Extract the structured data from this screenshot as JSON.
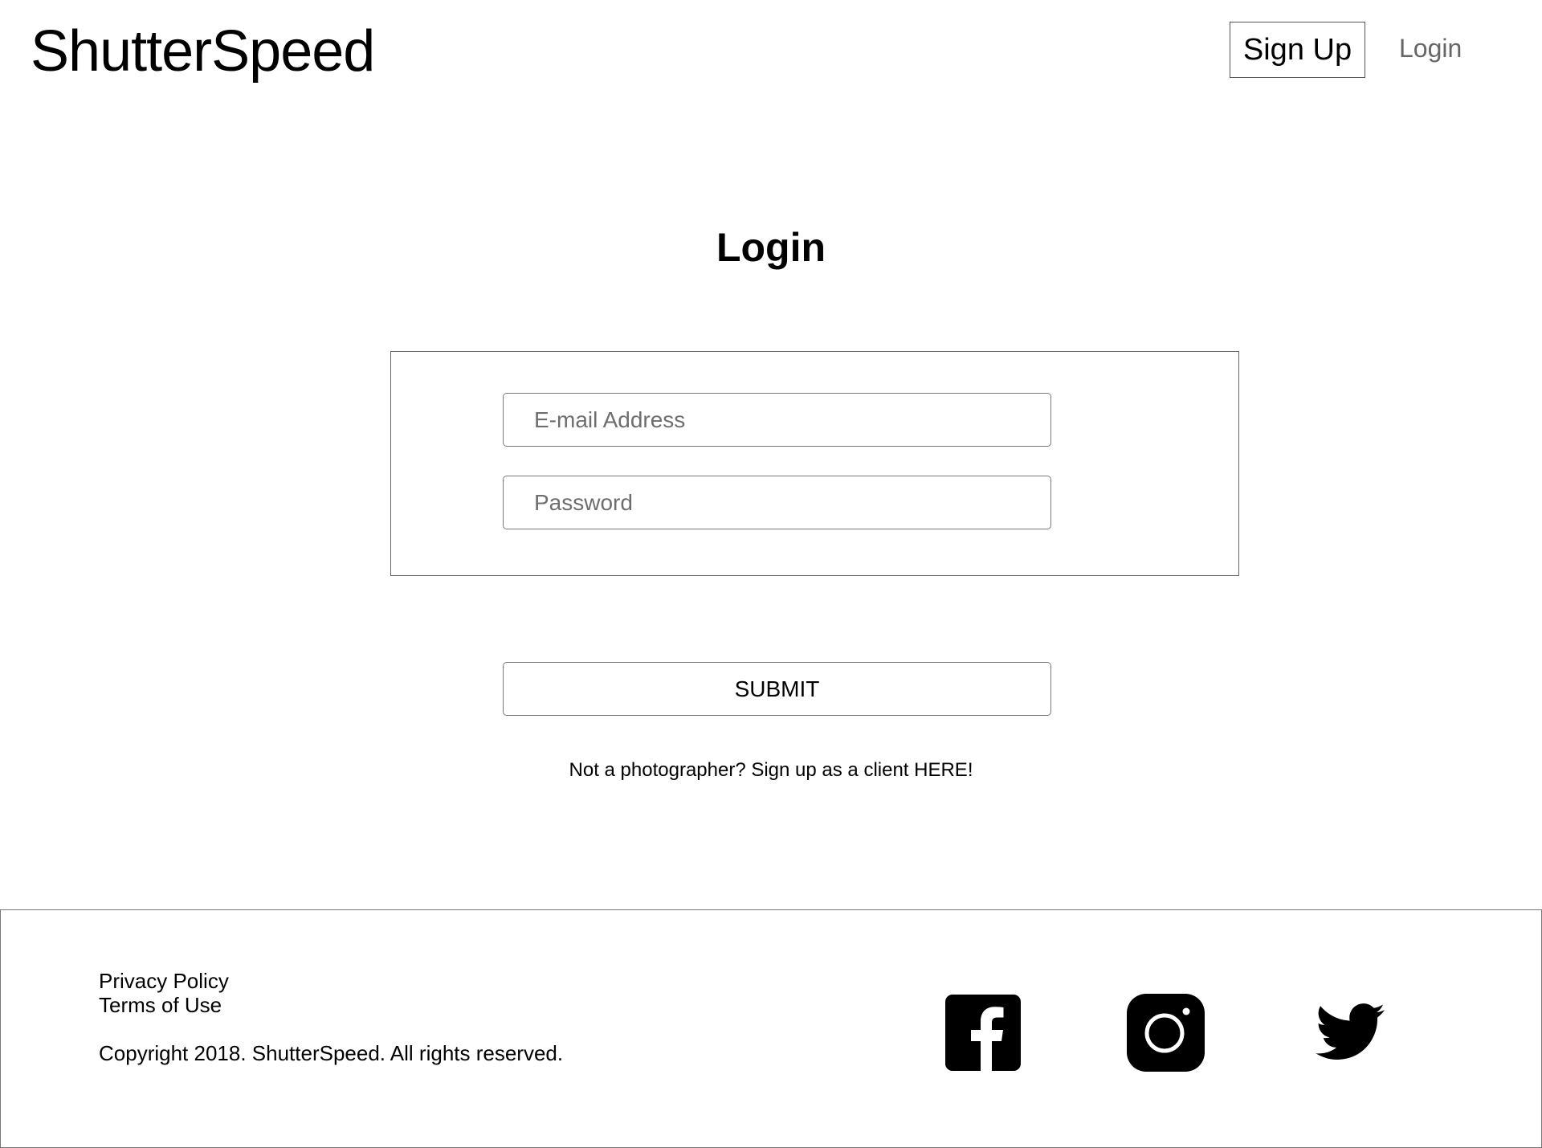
{
  "header": {
    "brand": "ShutterSpeed",
    "signup_label": "Sign Up",
    "login_label": "Login"
  },
  "main": {
    "title": "Login",
    "email_placeholder": "E-mail Address",
    "password_placeholder": "Password",
    "submit_label": "SUBMIT",
    "client_link": "Not a photographer? Sign up as a client HERE!"
  },
  "footer": {
    "privacy_label": "Privacy Policy",
    "terms_label": "Terms of Use",
    "copyright": "Copyright 2018. ShutterSpeed. All rights reserved.",
    "social_icons": [
      "facebook-icon",
      "instagram-icon",
      "twitter-icon"
    ]
  }
}
